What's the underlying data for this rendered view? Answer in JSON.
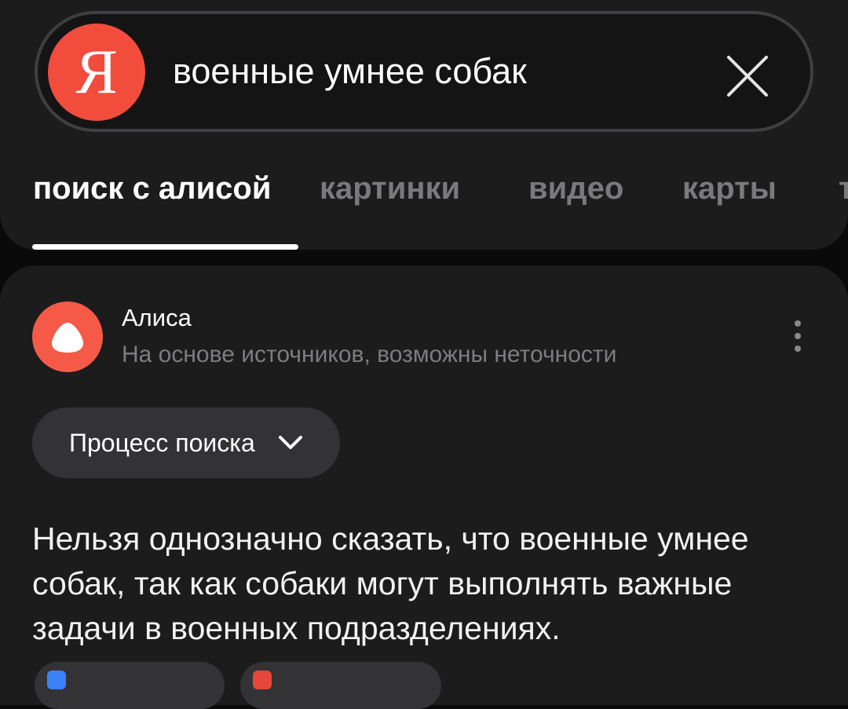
{
  "search": {
    "logo_letter": "Я",
    "query": "военные умнее собак"
  },
  "tabs": [
    {
      "label": "поиск с алисой",
      "active": true
    },
    {
      "label": "картинки",
      "active": false
    },
    {
      "label": "видео",
      "active": false
    },
    {
      "label": "карты",
      "active": false
    },
    {
      "label": "т",
      "active": false
    }
  ],
  "card": {
    "author": "Алиса",
    "disclaimer": "На основе источников, возможны неточности",
    "process_label": "Процесс поиска",
    "answer": "Нельзя однозначно сказать, что военные умнее собак, так как собаки могут выполнять важные задачи в военных подразделениях.",
    "sources": [
      {
        "label": "",
        "icon_color": "#3b82f6"
      },
      {
        "label": "",
        "icon_color": "#e5483b"
      }
    ]
  },
  "colors": {
    "yandex_red": "#f24c3d",
    "alice_orange": "#f55a48",
    "background": "#0a0a0a",
    "surface": "#1c1c1d"
  }
}
